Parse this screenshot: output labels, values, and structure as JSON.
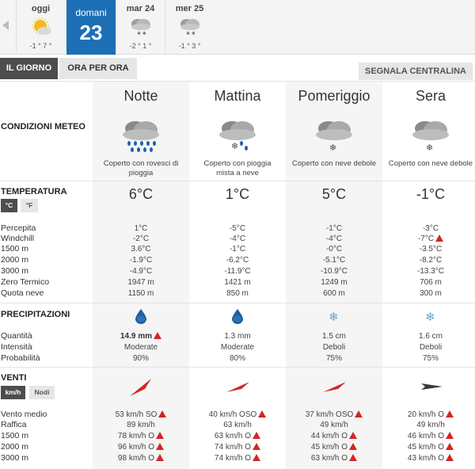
{
  "days": [
    {
      "name": "oggi",
      "temps": "-1 ° 7 °",
      "icon": "sun-cloud-icon"
    },
    {
      "name": "domani",
      "number": "23",
      "active": true
    },
    {
      "name": "mar 24",
      "temps": "-2 ° 1 °",
      "icon": "snow-cloud-icon"
    },
    {
      "name": "mer 25",
      "temps": "-1 ° 3 °",
      "icon": "snow-cloud-icon"
    }
  ],
  "tabs": {
    "giorno": "IL GIORNO",
    "ora": "ORA PER ORA",
    "segnala": "SEGNALA CENTRALINA"
  },
  "periods": [
    {
      "name": "Notte",
      "condition": "Coperto con rovesci di pioggia",
      "condition_l1": "Coperto con rovesci di",
      "condition_l2": "pioggia",
      "icon": "cloud-heavy-rain-icon",
      "temp": "6°C",
      "percepita": "1°C",
      "windchill": "-2°C",
      "t1500": "3.6°C",
      "t2000": "-1.9°C",
      "t3000": "-4.9°C",
      "zero_termico": "1947 m",
      "quota_neve": "1150 m",
      "quantita": "14.9 mm",
      "intensita": "Moderate",
      "probabilita": "90%",
      "precip_icon": "rain-drop-icon",
      "vento_medio": "53 km/h  SO",
      "raffica": "89 km/h",
      "v1500": "78 km/h O",
      "v2000": "96 km/h O",
      "v3000": "98 km/h O",
      "wind_dir_icon": "wind-arrow-sw-icon"
    },
    {
      "name": "Mattina",
      "condition": "Coperto con pioggia mista a neve",
      "condition_l1": "Coperto con pioggia",
      "condition_l2": "mista a neve",
      "icon": "cloud-sleet-icon",
      "temp": "1°C",
      "percepita": "-5°C",
      "windchill": "-4°C",
      "t1500": "-1°C",
      "t2000": "-6.2°C",
      "t3000": "-11.9°C",
      "zero_termico": "1421 m",
      "quota_neve": "850 m",
      "quantita": "1.3 mm",
      "intensita": "Moderate",
      "probabilita": "80%",
      "precip_icon": "rain-drop-icon",
      "vento_medio": "40 km/h  OSO",
      "raffica": "63 km/h",
      "v1500": "63 km/h O",
      "v2000": "74 km/h O",
      "v3000": "74 km/h O",
      "wind_dir_icon": "wind-arrow-wsw-icon"
    },
    {
      "name": "Pomeriggio",
      "condition": "Coperto con neve debole",
      "condition_l1": "Coperto con neve debole",
      "condition_l2": "",
      "icon": "cloud-snow-icon",
      "temp": "5°C",
      "percepita": "-1°C",
      "windchill": "-4°C",
      "t1500": "-0°C",
      "t2000": "-5.1°C",
      "t3000": "-10.9°C",
      "zero_termico": "1249 m",
      "quota_neve": "600 m",
      "quantita": "1.5 cm",
      "intensita": "Deboli",
      "probabilita": "75%",
      "precip_icon": "snowflake-icon",
      "vento_medio": "37 km/h  OSO",
      "raffica": "49 km/h",
      "v1500": "44 km/h O",
      "v2000": "45 km/h O",
      "v3000": "63 km/h O",
      "wind_dir_icon": "wind-arrow-wsw-icon"
    },
    {
      "name": "Sera",
      "condition": "Coperto con neve debole",
      "condition_l1": "Coperto con neve debole",
      "condition_l2": "",
      "icon": "cloud-snow-icon",
      "temp": "-1°C",
      "percepita": "-3°C",
      "windchill": "-7°C",
      "t1500": "-3.5°C",
      "t2000": "-8.2°C",
      "t3000": "-13.3°C",
      "zero_termico": "706 m",
      "quota_neve": "300 m",
      "quantita": "1.6 cm",
      "intensita": "Deboli",
      "probabilita": "75%",
      "precip_icon": "snowflake-icon",
      "vento_medio": "20 km/h  O",
      "raffica": "49 km/h",
      "v1500": "46 km/h O",
      "v2000": "45 km/h O",
      "v3000": "43 km/h O",
      "wind_dir_icon": "wind-arrow-w-icon"
    }
  ],
  "labels": {
    "condizioni": "CONDIZIONI METEO",
    "temperatura": "TEMPERATURA",
    "unit_c": "°C",
    "unit_f": "°F",
    "percepita": "Percepita",
    "windchill": "Windchill",
    "t1500": "1500 m",
    "t2000": "2000 m",
    "t3000": "3000 m",
    "zero_termico": "Zero Termico",
    "quota_neve": "Quota neve",
    "precipitazioni": "PRECIPITAZIONI",
    "quantita": "Quantità",
    "intensita": "Intensità",
    "probabilita": "Probabilità",
    "venti": "VENTI",
    "unit_kmh": "km/h",
    "unit_nodi": "Nodi",
    "vento_medio": "Vento medio",
    "raffica": "Raffica",
    "v1500": "1500 m",
    "v2000": "2000 m",
    "v3000": "3000 m"
  },
  "colors": {
    "accent": "#1c6fb4",
    "warning": "#d32626",
    "wind_arrow": "#d32626",
    "drop": "#1f6fb0"
  }
}
